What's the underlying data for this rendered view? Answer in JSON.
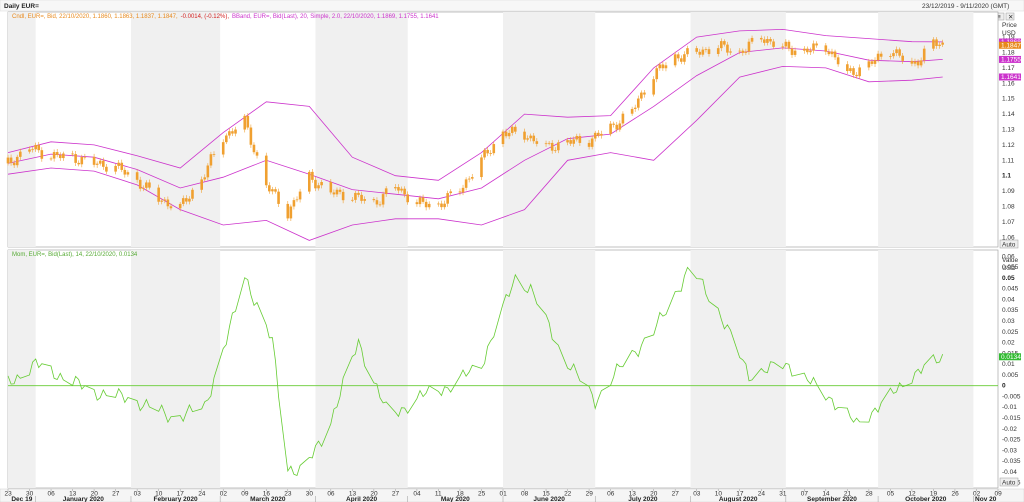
{
  "header": {
    "title": "Daily EUR=",
    "date_range": "23/12/2019 - 9/11/2020 (GMT)"
  },
  "toolbar": {
    "icons": [
      "link-icon",
      "menu-icon",
      "close-icon"
    ]
  },
  "legend": {
    "candle": "Cndl, EUR=, Bid, 22/10/2020, 1.1860, 1.1863, 1.1837, 1.1847,",
    "candle_change": "-0.0014, (-0.12%),",
    "bband": "BBand, EUR=, Bid(Last), 20, Simple, 2.0, 22/10/2020, 1.1869, 1.1755, 1.1641",
    "momentum": "Mom, EUR=, Bid(Last), 14, 22/10/2020, 0.0134"
  },
  "price_axis": {
    "title": "Price",
    "unit": "USD",
    "ticks": [
      "1.19",
      "1.18",
      "1.17",
      "1.16",
      "1.15",
      "1.14",
      "1.13",
      "1.12",
      "1.11",
      "1.1",
      "1.09",
      "1.08",
      "1.07",
      "1.06"
    ],
    "bold_ticks": [
      "1.1"
    ],
    "badges": [
      {
        "label": "1.1868",
        "value": 1.1868,
        "color": "#cc33cc"
      },
      {
        "label": "1.1847",
        "value": 1.1847,
        "color": "#e8891c"
      },
      {
        "label": "1.1755",
        "value": 1.1755,
        "color": "#cc33cc"
      },
      {
        "label": "1.1641",
        "value": 1.1641,
        "color": "#cc33cc"
      }
    ],
    "auto_button": "Auto"
  },
  "value_axis": {
    "title": "Value",
    "unit": "USD",
    "ticks": [
      "0.06",
      "0.055",
      "0.05",
      "0.045",
      "0.04",
      "0.035",
      "0.03",
      "0.025",
      "0.02",
      "0.015",
      "0.01",
      "0.005",
      "0",
      "-0.005",
      "-0.01",
      "-0.015",
      "-0.02",
      "-0.025",
      "-0.03",
      "-0.035",
      "-0.04",
      "-0.045"
    ],
    "bold_ticks": [
      "0.05",
      "0"
    ],
    "badge": {
      "label": "0.0134",
      "value": 0.0134,
      "color": "#33bb33"
    },
    "auto_button": "Auto"
  },
  "x_axis": {
    "day_ticks": [
      "23",
      "30",
      "06",
      "13",
      "20",
      "27",
      "03",
      "10",
      "17",
      "24",
      "02",
      "09",
      "16",
      "23",
      "30",
      "06",
      "13",
      "20",
      "27",
      "04",
      "11",
      "18",
      "25",
      "01",
      "08",
      "15",
      "22",
      "29",
      "06",
      "13",
      "20",
      "27",
      "03",
      "10",
      "17",
      "24",
      "31",
      "07",
      "14",
      "21",
      "28",
      "05",
      "12",
      "19",
      "26",
      "02",
      "09"
    ],
    "month_labels": [
      "Dec 19",
      "January 2020",
      "February 2020",
      "March 2020",
      "April 2020",
      "May 2020",
      "June 2020",
      "July 2020",
      "August 2020",
      "September 2020",
      "October 2020",
      "Nov 20"
    ]
  },
  "colors": {
    "candle": "#f0a030",
    "bband": "#cc33cc",
    "momentum": "#66cc33",
    "zero_line": "#66cc33",
    "legend_text": "#e8891c"
  },
  "chart_data": [
    {
      "type": "candlestick",
      "series_name": "EUR=",
      "y_unit": "USD",
      "ylim": [
        1.055,
        1.205
      ],
      "x_range": [
        "2019-12-23",
        "2020-11-09"
      ],
      "close_series": [
        [
          "2019-12-23",
          1.108
        ],
        [
          "2019-12-30",
          1.118
        ],
        [
          "2020-01-06",
          1.113
        ],
        [
          "2020-01-13",
          1.112
        ],
        [
          "2020-01-20",
          1.108
        ],
        [
          "2020-01-27",
          1.106
        ],
        [
          "2020-02-03",
          1.097
        ],
        [
          "2020-02-10",
          1.085
        ],
        [
          "2020-02-17",
          1.079
        ],
        [
          "2020-02-24",
          1.098
        ],
        [
          "2020-03-02",
          1.125
        ],
        [
          "2020-03-09",
          1.135
        ],
        [
          "2020-03-16",
          1.094
        ],
        [
          "2020-03-23",
          1.076
        ],
        [
          "2020-03-30",
          1.099
        ],
        [
          "2020-04-06",
          1.089
        ],
        [
          "2020-04-13",
          1.087
        ],
        [
          "2020-04-20",
          1.082
        ],
        [
          "2020-04-27",
          1.093
        ],
        [
          "2020-05-04",
          1.082
        ],
        [
          "2020-05-11",
          1.081
        ],
        [
          "2020-05-18",
          1.091
        ],
        [
          "2020-05-25",
          1.11
        ],
        [
          "2020-06-01",
          1.128
        ],
        [
          "2020-06-08",
          1.127
        ],
        [
          "2020-06-15",
          1.118
        ],
        [
          "2020-06-22",
          1.122
        ],
        [
          "2020-06-29",
          1.123
        ],
        [
          "2020-07-06",
          1.131
        ],
        [
          "2020-07-13",
          1.142
        ],
        [
          "2020-07-20",
          1.166
        ],
        [
          "2020-07-27",
          1.177
        ],
        [
          "2020-08-03",
          1.18
        ],
        [
          "2020-08-10",
          1.184
        ],
        [
          "2020-08-17",
          1.18
        ],
        [
          "2020-08-24",
          1.19
        ],
        [
          "2020-08-31",
          1.183
        ],
        [
          "2020-09-07",
          1.181
        ],
        [
          "2020-09-14",
          1.184
        ],
        [
          "2020-09-21",
          1.166
        ],
        [
          "2020-09-28",
          1.172
        ],
        [
          "2020-10-05",
          1.182
        ],
        [
          "2020-10-12",
          1.171
        ],
        [
          "2020-10-19",
          1.186
        ],
        [
          "2020-10-22",
          1.1847
        ]
      ],
      "bband_upper": [
        [
          "2019-12-23",
          1.115
        ],
        [
          "2020-01-06",
          1.122
        ],
        [
          "2020-01-20",
          1.12
        ],
        [
          "2020-02-03",
          1.113
        ],
        [
          "2020-02-17",
          1.105
        ],
        [
          "2020-03-02",
          1.128
        ],
        [
          "2020-03-16",
          1.148
        ],
        [
          "2020-03-30",
          1.145
        ],
        [
          "2020-04-13",
          1.112
        ],
        [
          "2020-04-27",
          1.1
        ],
        [
          "2020-05-11",
          1.097
        ],
        [
          "2020-05-25",
          1.115
        ],
        [
          "2020-06-08",
          1.14
        ],
        [
          "2020-06-22",
          1.138
        ],
        [
          "2020-07-06",
          1.139
        ],
        [
          "2020-07-20",
          1.17
        ],
        [
          "2020-08-03",
          1.19
        ],
        [
          "2020-08-17",
          1.194
        ],
        [
          "2020-08-31",
          1.195
        ],
        [
          "2020-09-14",
          1.191
        ],
        [
          "2020-09-28",
          1.189
        ],
        [
          "2020-10-12",
          1.187
        ],
        [
          "2020-10-22",
          1.1869
        ]
      ],
      "bband_middle": [
        [
          "2019-12-23",
          1.108
        ],
        [
          "2020-01-06",
          1.114
        ],
        [
          "2020-01-20",
          1.112
        ],
        [
          "2020-02-03",
          1.104
        ],
        [
          "2020-02-17",
          1.092
        ],
        [
          "2020-03-02",
          1.099
        ],
        [
          "2020-03-16",
          1.11
        ],
        [
          "2020-03-30",
          1.101
        ],
        [
          "2020-04-13",
          1.091
        ],
        [
          "2020-04-27",
          1.088
        ],
        [
          "2020-05-11",
          1.085
        ],
        [
          "2020-05-25",
          1.092
        ],
        [
          "2020-06-08",
          1.11
        ],
        [
          "2020-06-22",
          1.124
        ],
        [
          "2020-07-06",
          1.127
        ],
        [
          "2020-07-20",
          1.145
        ],
        [
          "2020-08-03",
          1.165
        ],
        [
          "2020-08-17",
          1.18
        ],
        [
          "2020-08-31",
          1.183
        ],
        [
          "2020-09-14",
          1.181
        ],
        [
          "2020-09-28",
          1.175
        ],
        [
          "2020-10-12",
          1.174
        ],
        [
          "2020-10-22",
          1.1755
        ]
      ],
      "bband_lower": [
        [
          "2019-12-23",
          1.101
        ],
        [
          "2020-01-06",
          1.105
        ],
        [
          "2020-01-20",
          1.103
        ],
        [
          "2020-02-03",
          1.094
        ],
        [
          "2020-02-17",
          1.078
        ],
        [
          "2020-03-02",
          1.068
        ],
        [
          "2020-03-16",
          1.071
        ],
        [
          "2020-03-30",
          1.058
        ],
        [
          "2020-04-13",
          1.068
        ],
        [
          "2020-04-27",
          1.072
        ],
        [
          "2020-05-11",
          1.072
        ],
        [
          "2020-05-25",
          1.068
        ],
        [
          "2020-06-08",
          1.078
        ],
        [
          "2020-06-22",
          1.11
        ],
        [
          "2020-07-06",
          1.115
        ],
        [
          "2020-07-20",
          1.11
        ],
        [
          "2020-08-03",
          1.136
        ],
        [
          "2020-08-17",
          1.164
        ],
        [
          "2020-08-31",
          1.171
        ],
        [
          "2020-09-14",
          1.17
        ],
        [
          "2020-09-28",
          1.161
        ],
        [
          "2020-10-12",
          1.162
        ],
        [
          "2020-10-22",
          1.1641
        ]
      ]
    },
    {
      "type": "line",
      "series_name": "Mom",
      "y_unit": "USD",
      "ylim": [
        -0.047,
        0.062
      ],
      "zero_line": 0,
      "values": [
        [
          "2019-12-23",
          0.001
        ],
        [
          "2020-01-01",
          0.01
        ],
        [
          "2020-01-10",
          0.004
        ],
        [
          "2020-01-20",
          -0.003
        ],
        [
          "2020-02-01",
          -0.006
        ],
        [
          "2020-02-15",
          -0.015
        ],
        [
          "2020-02-25",
          -0.01
        ],
        [
          "2020-03-05",
          0.03
        ],
        [
          "2020-03-09",
          0.051
        ],
        [
          "2020-03-18",
          0.02
        ],
        [
          "2020-03-23",
          -0.038
        ],
        [
          "2020-03-28",
          -0.04
        ],
        [
          "2020-04-05",
          -0.02
        ],
        [
          "2020-04-15",
          0.02
        ],
        [
          "2020-04-25",
          -0.015
        ],
        [
          "2020-05-05",
          -0.005
        ],
        [
          "2020-05-15",
          0.0
        ],
        [
          "2020-05-25",
          0.01
        ],
        [
          "2020-06-05",
          0.05
        ],
        [
          "2020-06-10",
          0.045
        ],
        [
          "2020-06-20",
          0.015
        ],
        [
          "2020-07-01",
          -0.007
        ],
        [
          "2020-07-10",
          0.01
        ],
        [
          "2020-07-20",
          0.025
        ],
        [
          "2020-08-01",
          0.055
        ],
        [
          "2020-08-10",
          0.035
        ],
        [
          "2020-08-20",
          0.005
        ],
        [
          "2020-09-01",
          0.01
        ],
        [
          "2020-09-15",
          -0.005
        ],
        [
          "2020-09-24",
          -0.018
        ],
        [
          "2020-10-05",
          -0.005
        ],
        [
          "2020-10-12",
          0.005
        ],
        [
          "2020-10-16",
          0.008
        ],
        [
          "2020-10-22",
          0.0134
        ]
      ]
    }
  ]
}
